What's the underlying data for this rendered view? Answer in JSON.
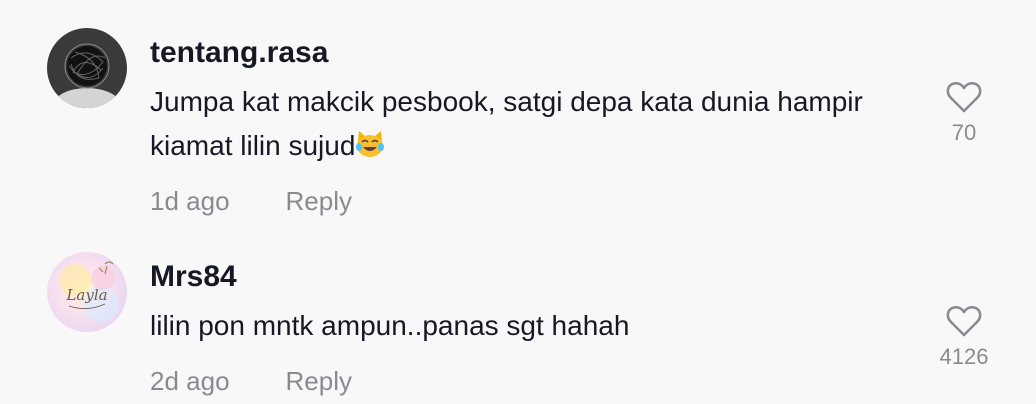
{
  "comments": [
    {
      "username": "tentang.rasa",
      "text": "Jumpa kat makcik pesbook, satgi depa kata dunia hampir kiamat lilin sujud",
      "emoji": "cat-tears-of-joy",
      "time": "1d ago",
      "reply_label": "Reply",
      "likes": "70",
      "avatar_icon": "scribbled-avatar"
    },
    {
      "username": "Mrs84",
      "text": "lilin pon mntk ampun..panas sgt hahah",
      "time": "2d ago",
      "reply_label": "Reply",
      "likes": "4126",
      "avatar_icon": "layla-logo-avatar",
      "avatar_text": "Layla"
    }
  ],
  "colors": {
    "background": "#f8f8f8",
    "text_primary": "#161823",
    "text_secondary": "#8a8b91"
  }
}
